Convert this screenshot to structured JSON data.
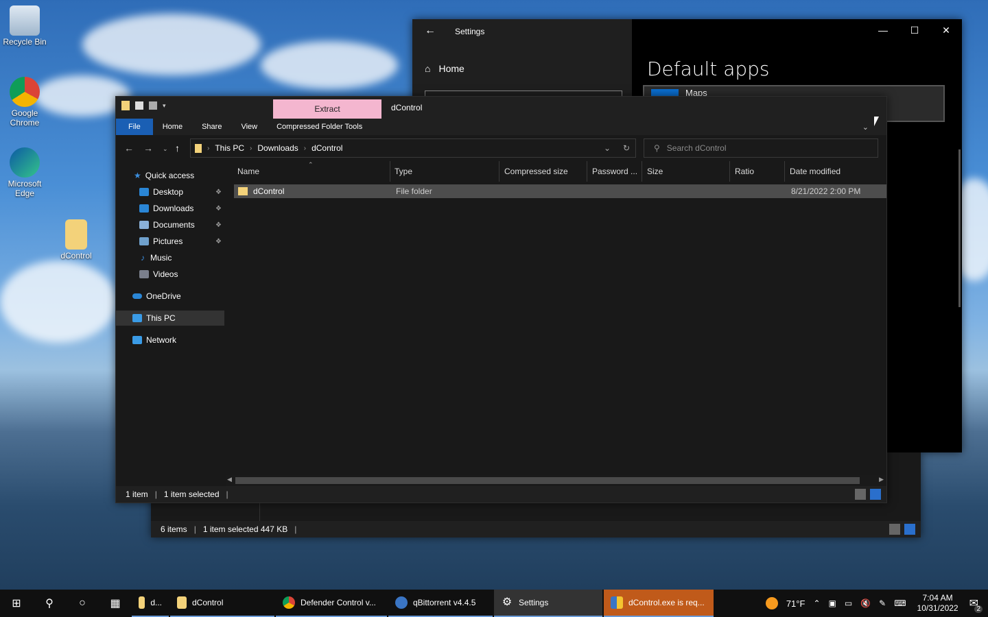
{
  "desktop": {
    "icons": [
      {
        "label": "Recycle Bin"
      },
      {
        "label": "Google Chrome"
      },
      {
        "label": "Microsoft Edge"
      },
      {
        "label": "dControl"
      }
    ]
  },
  "settings": {
    "title": "Settings",
    "home_label": "Home",
    "heading": "Default apps",
    "maps_label": "Maps"
  },
  "explorer": {
    "extract_tab": "Extract",
    "window_title": "dControl",
    "ribbon": {
      "file": "File",
      "home": "Home",
      "share": "Share",
      "view": "View",
      "tools": "Compressed Folder Tools"
    },
    "breadcrumb": [
      "This PC",
      "Downloads",
      "dControl"
    ],
    "search_placeholder": "Search dControl",
    "nav": {
      "quick_access": "Quick access",
      "desktop": "Desktop",
      "downloads": "Downloads",
      "documents": "Documents",
      "pictures": "Pictures",
      "music": "Music",
      "videos": "Videos",
      "onedrive": "OneDrive",
      "this_pc": "This PC",
      "network": "Network"
    },
    "columns": {
      "name": "Name",
      "type": "Type",
      "compressed": "Compressed size",
      "password": "Password ...",
      "size": "Size",
      "ratio": "Ratio",
      "date": "Date modified"
    },
    "rows": [
      {
        "name": "dControl",
        "type": "File folder",
        "date": "8/21/2022 2:00 PM"
      }
    ],
    "status": {
      "count": "1 item",
      "selected": "1 item selected"
    }
  },
  "explorer2": {
    "status": {
      "count": "6 items",
      "selected": "1 item selected  447 KB"
    }
  },
  "taskbar": {
    "apps": [
      {
        "label": "d..."
      },
      {
        "label": "dControl"
      },
      {
        "label": "Defender Control v..."
      },
      {
        "label": "qBittorrent v4.4.5"
      },
      {
        "label": "Settings"
      },
      {
        "label": "dControl.exe is req..."
      }
    ],
    "weather": "71°F",
    "time": "7:04 AM",
    "date": "10/31/2022",
    "notifications": "2"
  },
  "colors": {
    "accent": "#1a5fb4",
    "extract_tab": "#f4b6cf",
    "selection": "#4d4d4d",
    "alert_app": "#c05a1a"
  }
}
